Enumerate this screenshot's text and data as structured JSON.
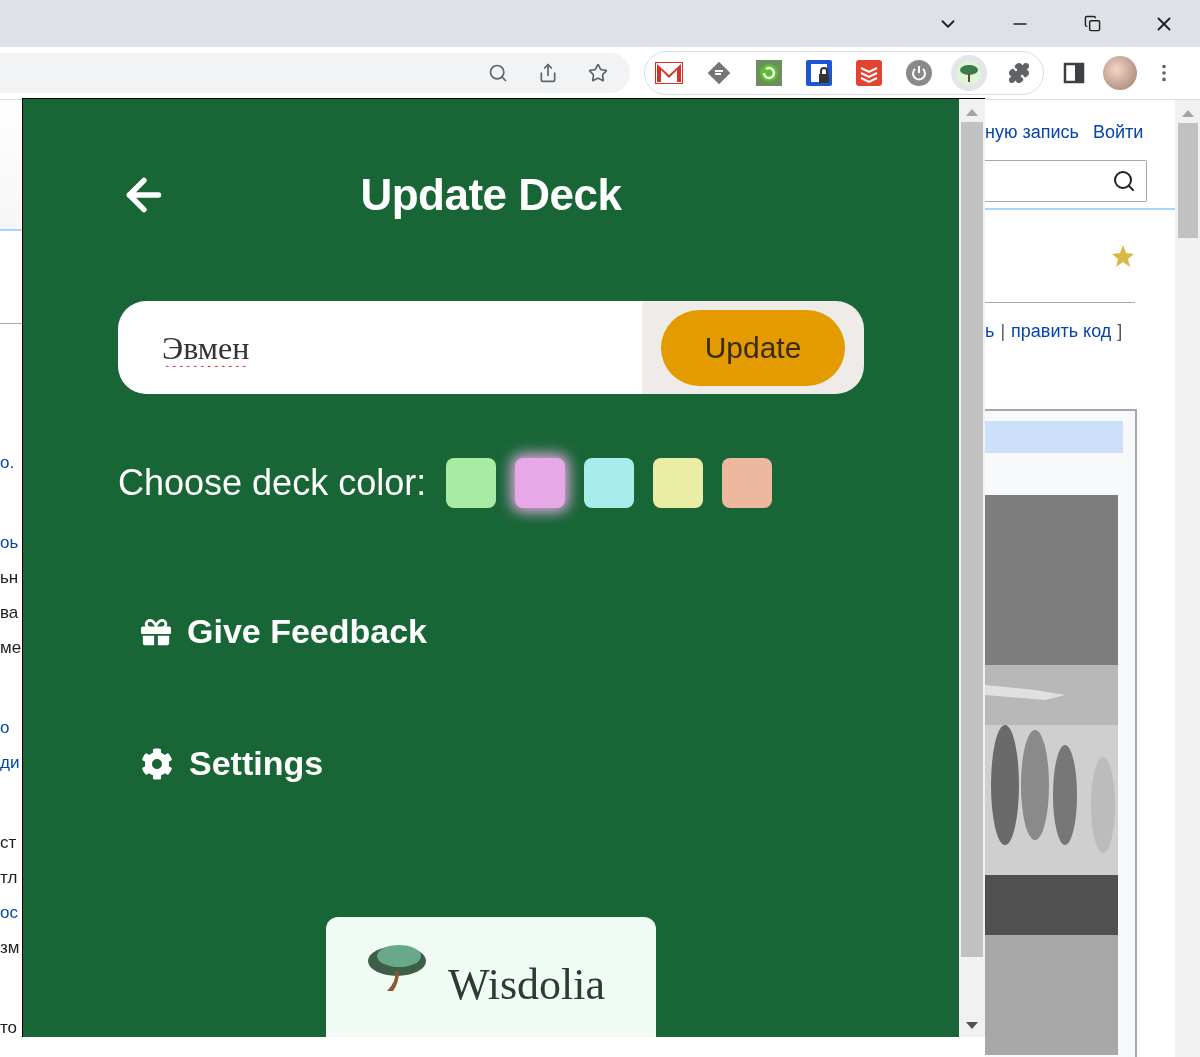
{
  "toolbar": {
    "extensions": [
      {
        "kind": "mail",
        "active": false
      },
      {
        "kind": "feed",
        "active": false
      },
      {
        "kind": "sync",
        "active": false
      },
      {
        "kind": "lock",
        "active": false
      },
      {
        "kind": "stack",
        "active": false
      },
      {
        "kind": "power",
        "active": false
      },
      {
        "kind": "tree",
        "active": true
      }
    ]
  },
  "page": {
    "header_links": [
      "ную запись",
      "Войти"
    ],
    "edit_links": [
      {
        "text": "ь",
        "kind": "link"
      },
      {
        "text": "|",
        "kind": "text"
      },
      {
        "text": "править код",
        "kind": "link"
      },
      {
        "text": "]",
        "kind": "text"
      }
    ],
    "left_paragraphs": [
      [
        [
          {
            "text": "о.",
            "kind": "link"
          }
        ]
      ],
      [
        [
          {
            "text": "оь",
            "kind": "link"
          }
        ],
        [
          {
            "text": "ьн",
            "kind": "text"
          }
        ],
        [
          {
            "text": "ва",
            "kind": "text"
          }
        ],
        [
          {
            "text": "ме",
            "kind": "text"
          }
        ]
      ],
      [
        [
          {
            "text": "о",
            "kind": "link"
          }
        ],
        [
          {
            "text": "ди",
            "kind": "link"
          }
        ]
      ],
      [
        [
          {
            "text": "ст",
            "kind": "text"
          }
        ],
        [
          {
            "text": "тл",
            "kind": "text"
          }
        ],
        [
          {
            "text": "ос",
            "kind": "link"
          }
        ],
        [
          {
            "text": "зм",
            "kind": "text"
          }
        ]
      ],
      [
        [
          {
            "text": "то",
            "kind": "text"
          }
        ]
      ]
    ]
  },
  "popup": {
    "title": "Update Deck",
    "deck_name": {
      "value": "Эвмен",
      "misspelled": true
    },
    "update_button": "Update",
    "color_label": "Choose deck color:",
    "colors": [
      {
        "color": "#a8eca4",
        "selected": false
      },
      {
        "color": "#e6a8e6",
        "selected": true
      },
      {
        "color": "#a8ecec",
        "selected": false
      },
      {
        "color": "#eaeea4",
        "selected": false
      },
      {
        "color": "#eeb8a0",
        "selected": false
      }
    ],
    "menu": [
      {
        "label": "Give Feedback",
        "kind": "gift"
      },
      {
        "label": "Settings",
        "kind": "gear"
      }
    ],
    "footer": {
      "brand": "Wisdolia"
    }
  }
}
